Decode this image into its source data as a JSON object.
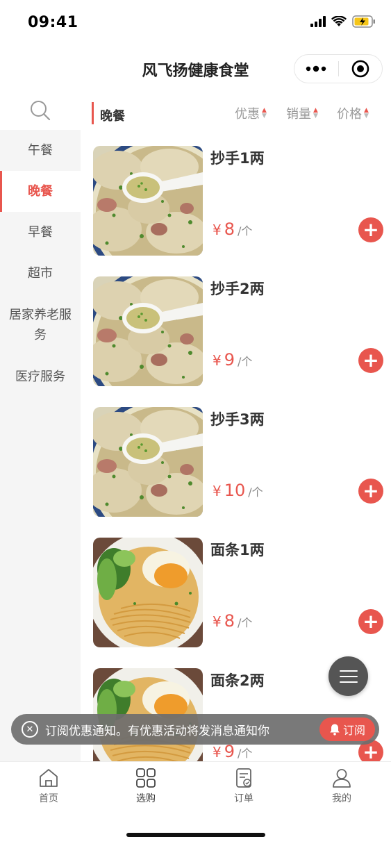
{
  "status_bar": {
    "time": "09:41"
  },
  "nav": {
    "title": "风飞扬健康食堂",
    "more_icon": "more-dots-icon",
    "close_icon": "target-close-icon"
  },
  "sidebar": {
    "search_icon": "search-icon",
    "items": [
      {
        "label": "午餐",
        "active": false
      },
      {
        "label": "晚餐",
        "active": true
      },
      {
        "label": "早餐",
        "active": false
      },
      {
        "label": "超市",
        "active": false
      },
      {
        "label": "居家养老服务",
        "active": false
      },
      {
        "label": "医疗服务",
        "active": false
      }
    ]
  },
  "header": {
    "category_title": "晚餐",
    "sorts": [
      {
        "label": "优惠"
      },
      {
        "label": "销量"
      },
      {
        "label": "价格"
      }
    ]
  },
  "products": [
    {
      "name": "抄手1两",
      "currency": "¥",
      "price": "8",
      "unit": "/个",
      "image": "wonton-soup"
    },
    {
      "name": "抄手2两",
      "currency": "¥",
      "price": "9",
      "unit": "/个",
      "image": "wonton-soup"
    },
    {
      "name": "抄手3两",
      "currency": "¥",
      "price": "10",
      "unit": "/个",
      "image": "wonton-soup"
    },
    {
      "name": "面条1两",
      "currency": "¥",
      "price": "8",
      "unit": "/个",
      "image": "noodle-egg"
    },
    {
      "name": "面条2两",
      "currency": "¥",
      "price": "9",
      "unit": "/个",
      "image": "noodle-egg"
    }
  ],
  "subscribe": {
    "text": "订阅优惠通知。有优惠活动将发消息通知你",
    "button": "订阅"
  },
  "tabs": [
    {
      "label": "首页",
      "icon": "home-icon"
    },
    {
      "label": "选购",
      "icon": "grid-icon",
      "active": true
    },
    {
      "label": "订单",
      "icon": "order-icon"
    },
    {
      "label": "我的",
      "icon": "user-icon"
    }
  ],
  "colors": {
    "accent": "#e8564e",
    "sidebar_bg": "#f5f5f5"
  }
}
